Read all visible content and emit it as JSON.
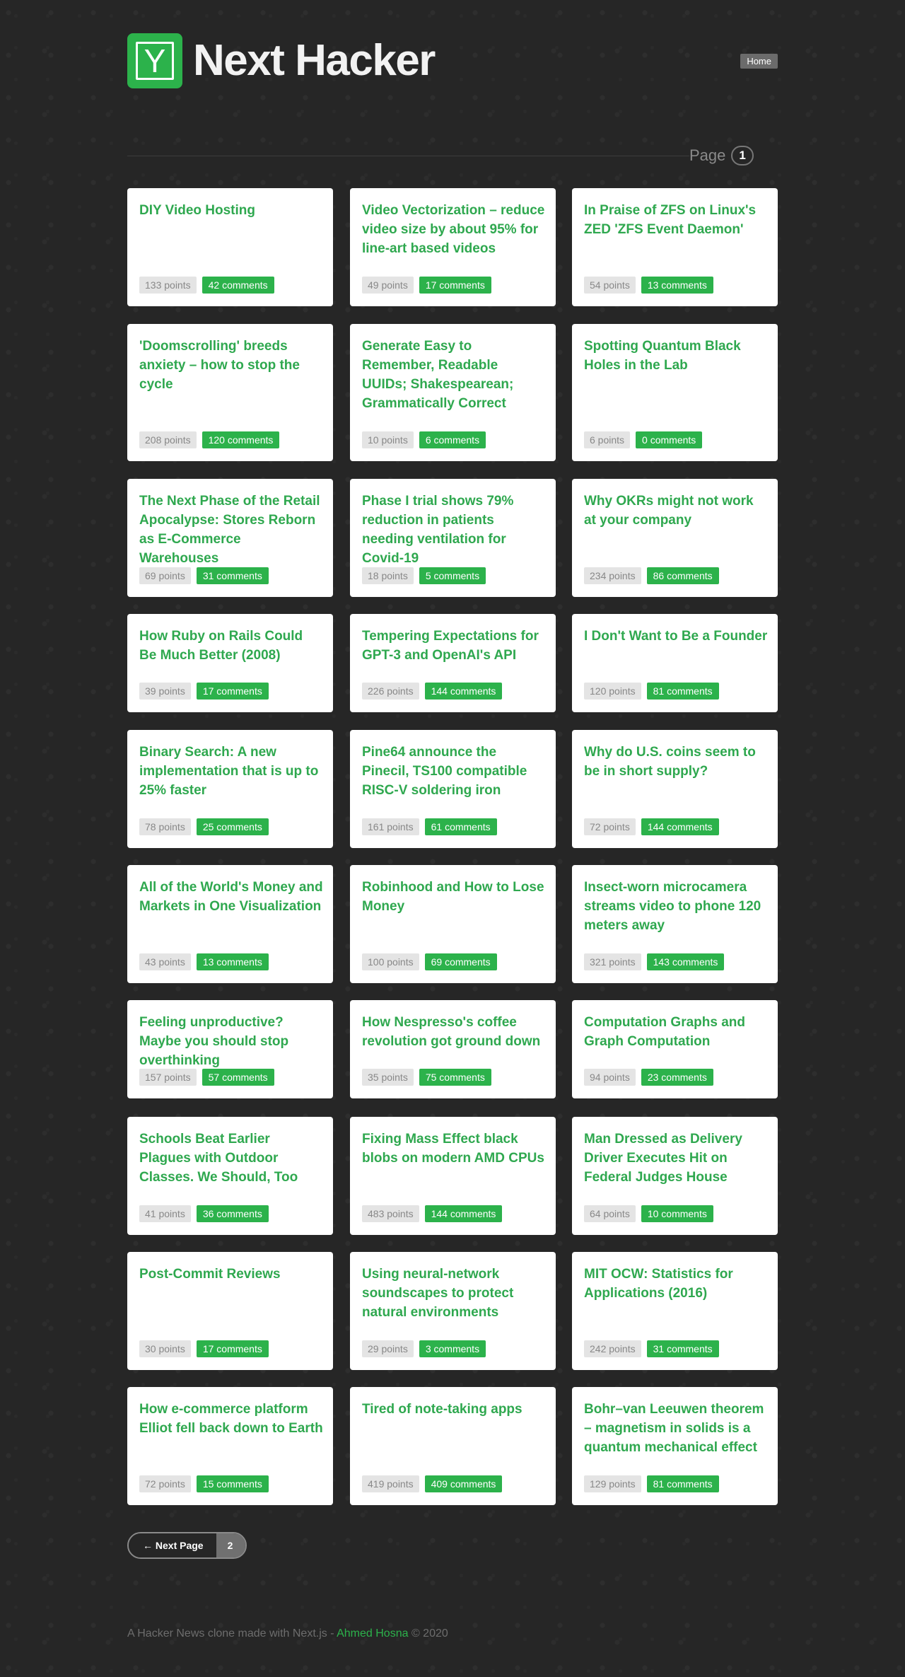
{
  "header": {
    "logo_letter": "Y",
    "title": "Next Hacker",
    "home_label": "Home"
  },
  "pager": {
    "label": "Page",
    "current": "1",
    "next_label": "← Next Page",
    "next_number": "2"
  },
  "stories": [
    {
      "title": "DIY Video Hosting",
      "points": "133 points",
      "comments": "42 comments"
    },
    {
      "title": "Video Vectorization – reduce video size by about 95% for line-art based videos",
      "points": "49 points",
      "comments": "17 comments"
    },
    {
      "title": "In Praise of ZFS on Linux's ZED 'ZFS Event Daemon'",
      "points": "54 points",
      "comments": "13 comments"
    },
    {
      "title": "'Doomscrolling' breeds anxiety – how to stop the cycle",
      "points": "208 points",
      "comments": "120 comments"
    },
    {
      "title": "Generate Easy to Remember, Readable UUIDs; Shakespearean; Grammatically Correct",
      "points": "10 points",
      "comments": "6 comments"
    },
    {
      "title": "Spotting Quantum Black Holes in the Lab",
      "points": "6 points",
      "comments": "0 comments"
    },
    {
      "title": "The Next Phase of the Retail Apocalypse: Stores Reborn as E-Commerce Warehouses",
      "points": "69 points",
      "comments": "31 comments"
    },
    {
      "title": "Phase I trial shows 79% reduction in patients needing ventilation for Covid-19",
      "points": "18 points",
      "comments": "5 comments"
    },
    {
      "title": "Why OKRs might not work at your company",
      "points": "234 points",
      "comments": "86 comments"
    },
    {
      "title": "How Ruby on Rails Could Be Much Better (2008)",
      "points": "39 points",
      "comments": "17 comments"
    },
    {
      "title": "Tempering Expectations for GPT-3 and OpenAI's API",
      "points": "226 points",
      "comments": "144 comments"
    },
    {
      "title": "I Don't Want to Be a Founder",
      "points": "120 points",
      "comments": "81 comments"
    },
    {
      "title": "Binary Search: A new implementation that is up to 25% faster",
      "points": "78 points",
      "comments": "25 comments"
    },
    {
      "title": "Pine64 announce the Pinecil, TS100 compatible RISC-V soldering iron",
      "points": "161 points",
      "comments": "61 comments"
    },
    {
      "title": "Why do U.S. coins seem to be in short supply?",
      "points": "72 points",
      "comments": "144 comments"
    },
    {
      "title": "All of the World's Money and Markets in One Visualization",
      "points": "43 points",
      "comments": "13 comments"
    },
    {
      "title": "Robinhood and How to Lose Money",
      "points": "100 points",
      "comments": "69 comments"
    },
    {
      "title": "Insect-worn microcamera streams video to phone 120 meters away",
      "points": "321 points",
      "comments": "143 comments"
    },
    {
      "title": "Feeling unproductive? Maybe you should stop overthinking",
      "points": "157 points",
      "comments": "57 comments"
    },
    {
      "title": "How Nespresso's coffee revolution got ground down",
      "points": "35 points",
      "comments": "75 comments"
    },
    {
      "title": "Computation Graphs and Graph Computation",
      "points": "94 points",
      "comments": "23 comments"
    },
    {
      "title": "Schools Beat Earlier Plagues with Outdoor Classes. We Should, Too",
      "points": "41 points",
      "comments": "36 comments"
    },
    {
      "title": "Fixing Mass Effect black blobs on modern AMD CPUs",
      "points": "483 points",
      "comments": "144 comments"
    },
    {
      "title": "Man Dressed as Delivery Driver Executes Hit on Federal Judges House",
      "points": "64 points",
      "comments": "10 comments"
    },
    {
      "title": "Post-Commit Reviews",
      "points": "30 points",
      "comments": "17 comments"
    },
    {
      "title": "Using neural-network soundscapes to protect natural environments",
      "points": "29 points",
      "comments": "3 comments"
    },
    {
      "title": "MIT OCW: Statistics for Applications (2016)",
      "points": "242 points",
      "comments": "31 comments"
    },
    {
      "title": "How e-commerce platform Elliot fell back down to Earth",
      "points": "72 points",
      "comments": "15 comments"
    },
    {
      "title": "Tired of note-taking apps",
      "points": "419 points",
      "comments": "409 comments"
    },
    {
      "title": "Bohr–van Leeuwen theorem – magnetism in solids is a quantum mechanical effect",
      "points": "129 points",
      "comments": "81 comments"
    }
  ],
  "footer": {
    "prefix": "A Hacker News clone made with Next.js - ",
    "author": "Ahmed Hosna",
    "suffix": " © 2020"
  }
}
